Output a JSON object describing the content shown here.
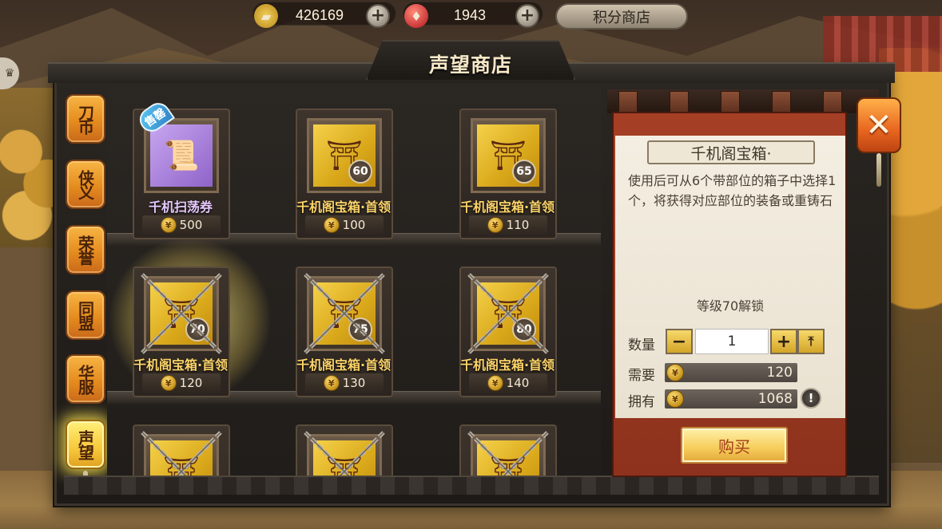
{
  "top_bar": {
    "currency1": {
      "icon": "gold-ingot-icon",
      "value": "426169"
    },
    "currency2": {
      "icon": "red-gem-icon",
      "value": "1943"
    },
    "plus_label": "+",
    "points_shop_label": "积分商店"
  },
  "title": "声望商店",
  "tabs": [
    {
      "label": "刀币",
      "active": false
    },
    {
      "label": "侠义",
      "active": false
    },
    {
      "label": "荣誉",
      "active": false
    },
    {
      "label": "同盟",
      "active": false
    },
    {
      "label": "华服",
      "active": false
    },
    {
      "label": "声望",
      "active": true
    }
  ],
  "items": [
    {
      "name": "千机扫荡券",
      "price": "500",
      "badge": "",
      "sale_tag": "售罄",
      "locked": false,
      "kind": "ticket"
    },
    {
      "name": "千机阁宝箱·首领",
      "price": "100",
      "badge": "60",
      "sale_tag": "",
      "locked": false,
      "kind": "box"
    },
    {
      "name": "千机阁宝箱·首领",
      "price": "110",
      "badge": "65",
      "sale_tag": "",
      "locked": false,
      "kind": "box"
    },
    {
      "name": "千机阁宝箱·首领",
      "price": "120",
      "badge": "70",
      "sale_tag": "",
      "locked": true,
      "kind": "box",
      "selected": true
    },
    {
      "name": "千机阁宝箱·首领",
      "price": "130",
      "badge": "75",
      "sale_tag": "",
      "locked": true,
      "kind": "box"
    },
    {
      "name": "千机阁宝箱·首领",
      "price": "140",
      "badge": "80",
      "sale_tag": "",
      "locked": true,
      "kind": "box"
    },
    {
      "name": "",
      "price": "",
      "badge": "",
      "sale_tag": "",
      "locked": true,
      "kind": "box"
    },
    {
      "name": "",
      "price": "",
      "badge": "",
      "sale_tag": "",
      "locked": true,
      "kind": "box"
    },
    {
      "name": "",
      "price": "",
      "badge": "",
      "sale_tag": "",
      "locked": true,
      "kind": "box"
    }
  ],
  "detail": {
    "title": "千机阁宝箱·",
    "description": "使用后可从6个带部位的箱子中选择1个，将获得对应部位的装备或重铸石",
    "unlock": "等级70解锁",
    "quantity_label": "数量",
    "quantity": "1",
    "minus_label": "−",
    "plus_label": "+",
    "need_label": "需要",
    "need_value": "120",
    "own_label": "拥有",
    "own_value": "1068",
    "info_label": "!",
    "buy_label": "购买"
  },
  "close_label": "✕",
  "colors": {
    "accent_orange": "#e58c1f",
    "gold_text": "#fcd46a",
    "panel_red": "#a53f25"
  }
}
